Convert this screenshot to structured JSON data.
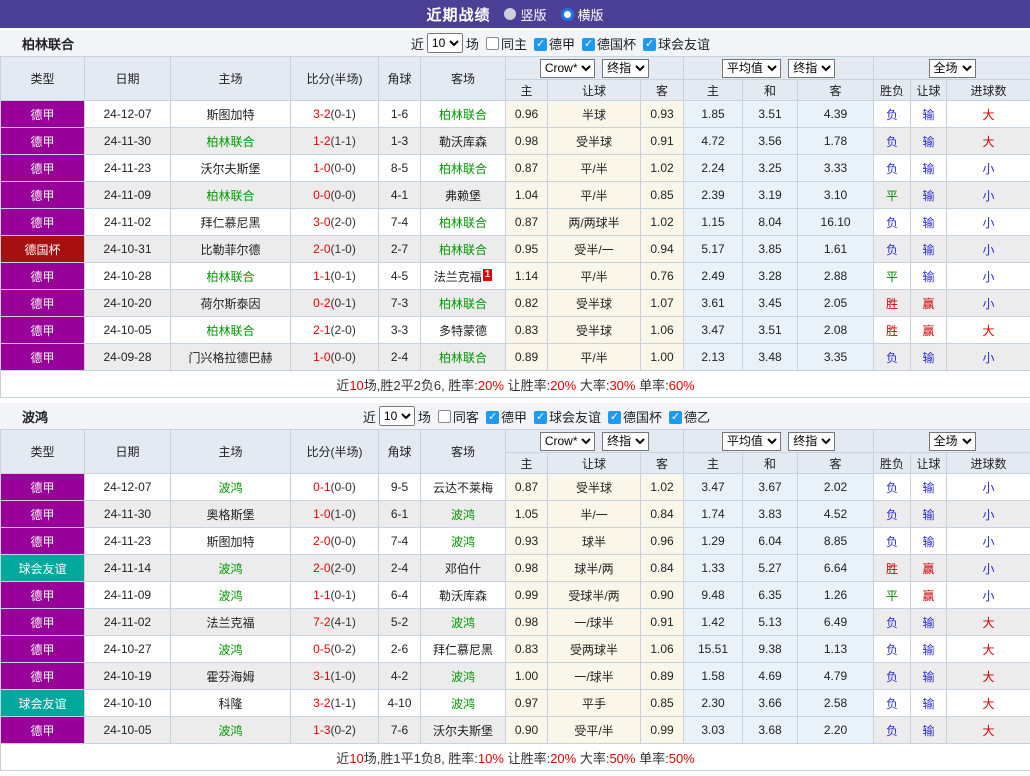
{
  "title_bar": {
    "title": "近期战绩",
    "layout_options": [
      {
        "label": "竖版",
        "selected": false
      },
      {
        "label": "横版",
        "selected": true
      }
    ]
  },
  "table_header": {
    "left_columns": [
      "类型",
      "日期",
      "主场",
      "比分(半场)",
      "角球",
      "客场"
    ],
    "odds_selects": [
      "Crow*",
      "终指"
    ],
    "odds_columns": [
      "主",
      "让球",
      "客"
    ],
    "avg_selects": [
      "平均值",
      "终指"
    ],
    "avg_columns": [
      "主",
      "和",
      "客"
    ],
    "full_select": "全场",
    "full_columns": [
      "胜负",
      "让球",
      "进球数"
    ]
  },
  "league_colors": {
    "德甲": "#990099",
    "德国杯": "#A61010",
    "球会友谊": "#00A79B",
    "德乙": "#990099"
  },
  "result_colors": {
    "胜": "#D10000",
    "赢": "#D10000",
    "大": "#D10000",
    "平": "#008800",
    "负": "#2B2BD5",
    "输": "#2B2BD5",
    "小": "#2B2BD5"
  },
  "accent_colors": {
    "title_bar": "#4B3F96",
    "self_team": "#009900",
    "score_red": "#E60000",
    "checkbox_blue": "#1E9BF0"
  },
  "sections": [
    {
      "team": "柏林联合",
      "filter": {
        "near_label": "近",
        "count": "10",
        "games_label": "场",
        "venue": {
          "label": "同主",
          "checked": false
        },
        "leagues": [
          {
            "label": "德甲",
            "checked": true
          },
          {
            "label": "德国杯",
            "checked": true
          },
          {
            "label": "球会友谊",
            "checked": true
          }
        ]
      },
      "rows": [
        {
          "type": "德甲",
          "date": "24-12-07",
          "home": {
            "name": "斯图加特",
            "self": false
          },
          "score": "3-2",
          "half": "(0-1)",
          "corner": "1-6",
          "away": {
            "name": "柏林联合",
            "self": true
          },
          "odds": [
            "0.96",
            "半球",
            "0.93"
          ],
          "avg": [
            "1.85",
            "3.51",
            "4.39"
          ],
          "results": [
            "负",
            "输",
            "大"
          ]
        },
        {
          "type": "德甲",
          "date": "24-11-30",
          "home": {
            "name": "柏林联合",
            "self": true
          },
          "score": "1-2",
          "half": "(1-1)",
          "corner": "1-3",
          "away": {
            "name": "勒沃库森",
            "self": false
          },
          "odds": [
            "0.98",
            "受半球",
            "0.91"
          ],
          "avg": [
            "4.72",
            "3.56",
            "1.78"
          ],
          "results": [
            "负",
            "输",
            "大"
          ]
        },
        {
          "type": "德甲",
          "date": "24-11-23",
          "home": {
            "name": "沃尔夫斯堡",
            "self": false
          },
          "score": "1-0",
          "half": "(0-0)",
          "corner": "8-5",
          "away": {
            "name": "柏林联合",
            "self": true
          },
          "odds": [
            "0.87",
            "平/半",
            "1.02"
          ],
          "avg": [
            "2.24",
            "3.25",
            "3.33"
          ],
          "results": [
            "负",
            "输",
            "小"
          ]
        },
        {
          "type": "德甲",
          "date": "24-11-09",
          "home": {
            "name": "柏林联合",
            "self": true
          },
          "score": "0-0",
          "half": "(0-0)",
          "corner": "4-1",
          "away": {
            "name": "弗赖堡",
            "self": false
          },
          "odds": [
            "1.04",
            "平/半",
            "0.85"
          ],
          "avg": [
            "2.39",
            "3.19",
            "3.10"
          ],
          "results": [
            "平",
            "输",
            "小"
          ]
        },
        {
          "type": "德甲",
          "date": "24-11-02",
          "home": {
            "name": "拜仁慕尼黑",
            "self": false
          },
          "score": "3-0",
          "half": "(2-0)",
          "corner": "7-4",
          "away": {
            "name": "柏林联合",
            "self": true
          },
          "odds": [
            "0.87",
            "两/两球半",
            "1.02"
          ],
          "avg": [
            "1.15",
            "8.04",
            "16.10"
          ],
          "results": [
            "负",
            "输",
            "小"
          ]
        },
        {
          "type": "德国杯",
          "date": "24-10-31",
          "home": {
            "name": "比勒菲尔德",
            "self": false
          },
          "score": "2-0",
          "half": "(1-0)",
          "corner": "2-7",
          "away": {
            "name": "柏林联合",
            "self": true
          },
          "odds": [
            "0.95",
            "受半/一",
            "0.94"
          ],
          "avg": [
            "5.17",
            "3.85",
            "1.61"
          ],
          "results": [
            "负",
            "输",
            "小"
          ]
        },
        {
          "type": "德甲",
          "date": "24-10-28",
          "home": {
            "name": "柏林联合",
            "self": true
          },
          "score": "1-1",
          "half": "(0-1)",
          "corner": "4-5",
          "away": {
            "name": "法兰克福",
            "self": false,
            "sup": "1"
          },
          "odds": [
            "1.14",
            "平/半",
            "0.76"
          ],
          "avg": [
            "2.49",
            "3.28",
            "2.88"
          ],
          "results": [
            "平",
            "输",
            "小"
          ]
        },
        {
          "type": "德甲",
          "date": "24-10-20",
          "home": {
            "name": "荷尔斯泰因",
            "self": false
          },
          "score": "0-2",
          "half": "(0-1)",
          "corner": "7-3",
          "away": {
            "name": "柏林联合",
            "self": true
          },
          "odds": [
            "0.82",
            "受半球",
            "1.07"
          ],
          "avg": [
            "3.61",
            "3.45",
            "2.05"
          ],
          "results": [
            "胜",
            "赢",
            "小"
          ]
        },
        {
          "type": "德甲",
          "date": "24-10-05",
          "home": {
            "name": "柏林联合",
            "self": true
          },
          "score": "2-1",
          "half": "(2-0)",
          "corner": "3-3",
          "away": {
            "name": "多特蒙德",
            "self": false
          },
          "odds": [
            "0.83",
            "受半球",
            "1.06"
          ],
          "avg": [
            "3.47",
            "3.51",
            "2.08"
          ],
          "results": [
            "胜",
            "赢",
            "大"
          ]
        },
        {
          "type": "德甲",
          "date": "24-09-28",
          "home": {
            "name": "门兴格拉德巴赫",
            "self": false
          },
          "score": "1-0",
          "half": "(0-0)",
          "corner": "2-4",
          "away": {
            "name": "柏林联合",
            "self": true
          },
          "odds": [
            "0.89",
            "平/半",
            "1.00"
          ],
          "avg": [
            "2.13",
            "3.48",
            "3.35"
          ],
          "results": [
            "负",
            "输",
            "小"
          ]
        }
      ],
      "summary": [
        {
          "t": "近"
        },
        {
          "t": "10",
          "r": true
        },
        {
          "t": "场,胜2平2负6, 胜率:"
        },
        {
          "t": "20%",
          "r": true
        },
        {
          "t": " 让胜率:"
        },
        {
          "t": "20%",
          "r": true
        },
        {
          "t": " 大率:"
        },
        {
          "t": "30%",
          "r": true
        },
        {
          "t": " 单率:"
        },
        {
          "t": "60%",
          "r": true
        }
      ]
    },
    {
      "team": "波鸿",
      "filter": {
        "near_label": "近",
        "count": "10",
        "games_label": "场",
        "venue": {
          "label": "同客",
          "checked": false
        },
        "leagues": [
          {
            "label": "德甲",
            "checked": true
          },
          {
            "label": "球会友谊",
            "checked": true
          },
          {
            "label": "德国杯",
            "checked": true
          },
          {
            "label": "德乙",
            "checked": true
          }
        ]
      },
      "rows": [
        {
          "type": "德甲",
          "date": "24-12-07",
          "home": {
            "name": "波鸿",
            "self": true
          },
          "score": "0-1",
          "half": "(0-0)",
          "corner": "9-5",
          "away": {
            "name": "云达不莱梅",
            "self": false
          },
          "odds": [
            "0.87",
            "受半球",
            "1.02"
          ],
          "avg": [
            "3.47",
            "3.67",
            "2.02"
          ],
          "results": [
            "负",
            "输",
            "小"
          ]
        },
        {
          "type": "德甲",
          "date": "24-11-30",
          "home": {
            "name": "奥格斯堡",
            "self": false
          },
          "score": "1-0",
          "half": "(1-0)",
          "corner": "6-1",
          "away": {
            "name": "波鸿",
            "self": true
          },
          "odds": [
            "1.05",
            "半/一",
            "0.84"
          ],
          "avg": [
            "1.74",
            "3.83",
            "4.52"
          ],
          "results": [
            "负",
            "输",
            "小"
          ]
        },
        {
          "type": "德甲",
          "date": "24-11-23",
          "home": {
            "name": "斯图加特",
            "self": false
          },
          "score": "2-0",
          "half": "(0-0)",
          "corner": "7-4",
          "away": {
            "name": "波鸿",
            "self": true
          },
          "odds": [
            "0.93",
            "球半",
            "0.96"
          ],
          "avg": [
            "1.29",
            "6.04",
            "8.85"
          ],
          "results": [
            "负",
            "输",
            "小"
          ]
        },
        {
          "type": "球会友谊",
          "date": "24-11-14",
          "home": {
            "name": "波鸿",
            "self": true
          },
          "score": "2-0",
          "half": "(2-0)",
          "corner": "2-4",
          "away": {
            "name": "邓伯什",
            "self": false
          },
          "odds": [
            "0.98",
            "球半/两",
            "0.84"
          ],
          "avg": [
            "1.33",
            "5.27",
            "6.64"
          ],
          "results": [
            "胜",
            "赢",
            "小"
          ]
        },
        {
          "type": "德甲",
          "date": "24-11-09",
          "home": {
            "name": "波鸿",
            "self": true
          },
          "score": "1-1",
          "half": "(0-1)",
          "corner": "6-4",
          "away": {
            "name": "勒沃库森",
            "self": false
          },
          "odds": [
            "0.99",
            "受球半/两",
            "0.90"
          ],
          "avg": [
            "9.48",
            "6.35",
            "1.26"
          ],
          "results": [
            "平",
            "赢",
            "小"
          ]
        },
        {
          "type": "德甲",
          "date": "24-11-02",
          "home": {
            "name": "法兰克福",
            "self": false
          },
          "score": "7-2",
          "half": "(4-1)",
          "corner": "5-2",
          "away": {
            "name": "波鸿",
            "self": true
          },
          "odds": [
            "0.98",
            "一/球半",
            "0.91"
          ],
          "avg": [
            "1.42",
            "5.13",
            "6.49"
          ],
          "results": [
            "负",
            "输",
            "大"
          ]
        },
        {
          "type": "德甲",
          "date": "24-10-27",
          "home": {
            "name": "波鸿",
            "self": true
          },
          "score": "0-5",
          "half": "(0-2)",
          "corner": "2-6",
          "away": {
            "name": "拜仁慕尼黑",
            "self": false
          },
          "odds": [
            "0.83",
            "受两球半",
            "1.06"
          ],
          "avg": [
            "15.51",
            "9.38",
            "1.13"
          ],
          "results": [
            "负",
            "输",
            "大"
          ]
        },
        {
          "type": "德甲",
          "date": "24-10-19",
          "home": {
            "name": "霍芬海姆",
            "self": false
          },
          "score": "3-1",
          "half": "(1-0)",
          "corner": "4-2",
          "away": {
            "name": "波鸿",
            "self": true
          },
          "odds": [
            "1.00",
            "一/球半",
            "0.89"
          ],
          "avg": [
            "1.58",
            "4.69",
            "4.79"
          ],
          "results": [
            "负",
            "输",
            "大"
          ]
        },
        {
          "type": "球会友谊",
          "date": "24-10-10",
          "home": {
            "name": "科隆",
            "self": false
          },
          "score": "3-2",
          "half": "(1-1)",
          "corner": "4-10",
          "away": {
            "name": "波鸿",
            "self": true
          },
          "odds": [
            "0.97",
            "平手",
            "0.85"
          ],
          "avg": [
            "2.30",
            "3.66",
            "2.58"
          ],
          "results": [
            "负",
            "输",
            "大"
          ]
        },
        {
          "type": "德甲",
          "date": "24-10-05",
          "home": {
            "name": "波鸿",
            "self": true
          },
          "score": "1-3",
          "half": "(0-2)",
          "corner": "7-6",
          "away": {
            "name": "沃尔夫斯堡",
            "self": false
          },
          "odds": [
            "0.90",
            "受平/半",
            "0.99"
          ],
          "avg": [
            "3.03",
            "3.68",
            "2.20"
          ],
          "results": [
            "负",
            "输",
            "大"
          ]
        }
      ],
      "summary": [
        {
          "t": "近"
        },
        {
          "t": "10",
          "r": true
        },
        {
          "t": "场,胜1平1负8, 胜率:"
        },
        {
          "t": "10%",
          "r": true
        },
        {
          "t": " 让胜率:"
        },
        {
          "t": "20%",
          "r": true
        },
        {
          "t": " 大率:"
        },
        {
          "t": "50%",
          "r": true
        },
        {
          "t": " 单率:"
        },
        {
          "t": "50%",
          "r": true
        }
      ]
    }
  ]
}
